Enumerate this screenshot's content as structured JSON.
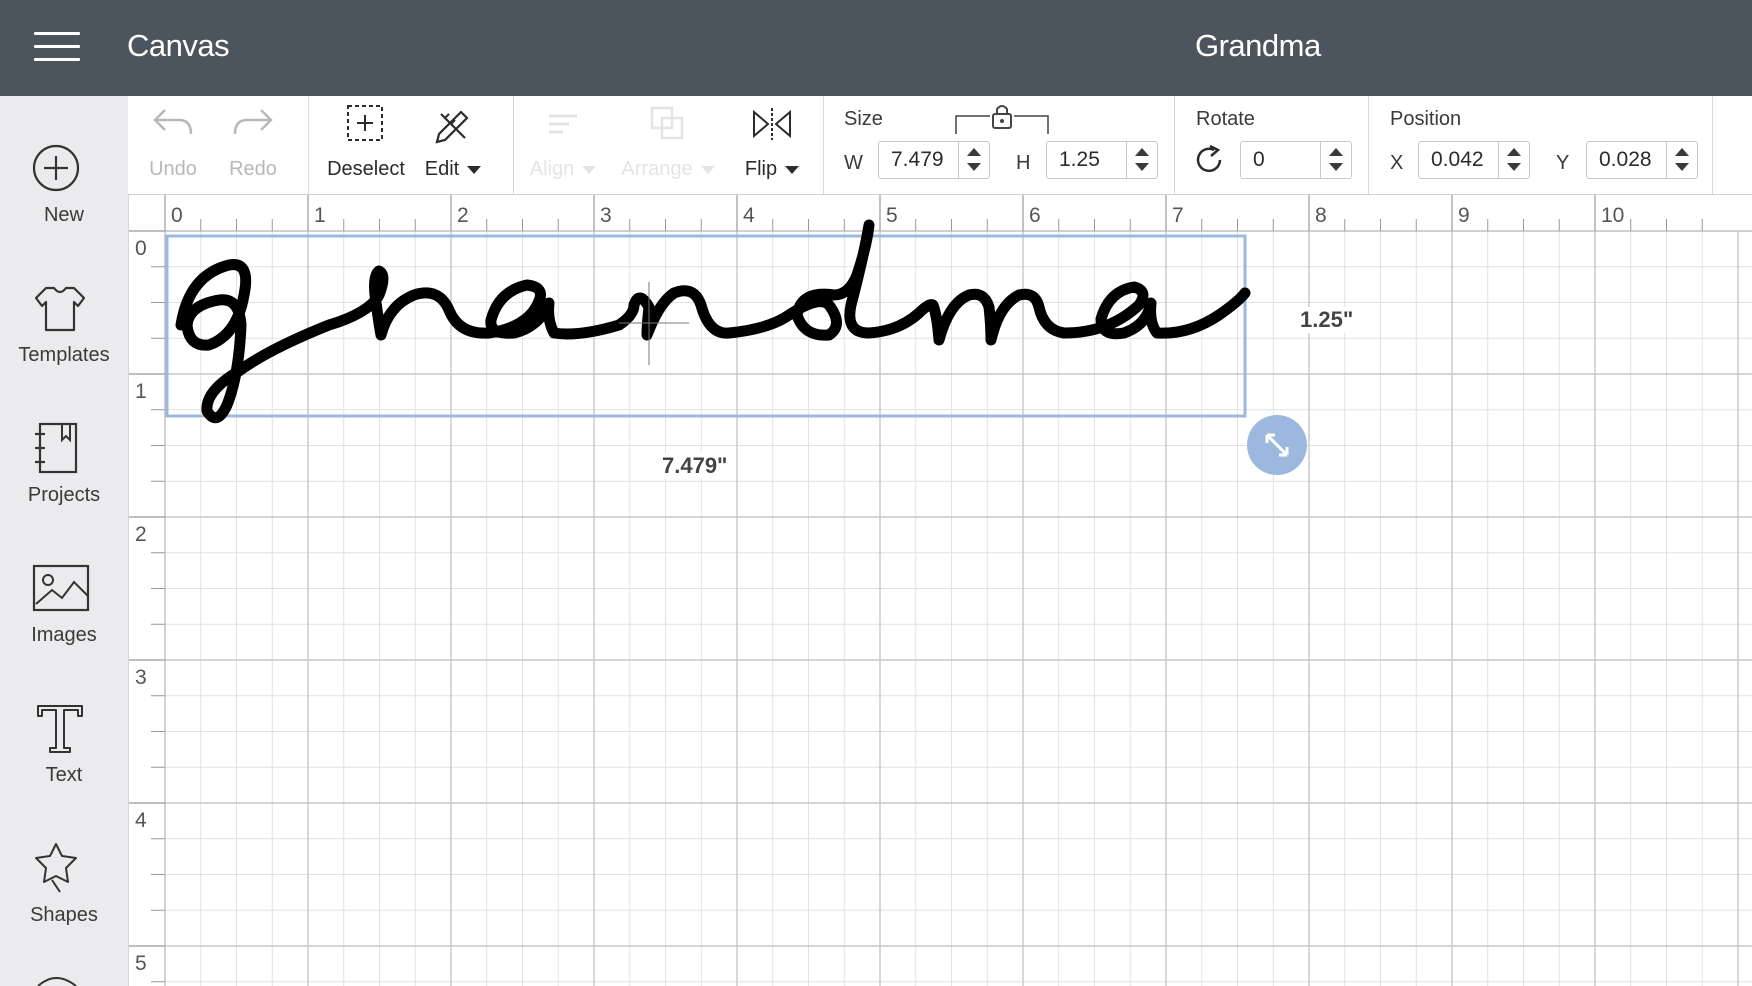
{
  "header": {
    "app_title": "Canvas",
    "doc_title": "Grandma",
    "menu_icon": "hamburger-menu-icon"
  },
  "sidebar": {
    "items": [
      {
        "label": "New",
        "icon": "plus-circle-icon"
      },
      {
        "label": "Templates",
        "icon": "tshirt-icon"
      },
      {
        "label": "Projects",
        "icon": "notebook-icon"
      },
      {
        "label": "Images",
        "icon": "image-icon"
      },
      {
        "label": "Text",
        "icon": "text-T-icon"
      },
      {
        "label": "Shapes",
        "icon": "shapes-icon"
      }
    ]
  },
  "toolbar": {
    "undo": "Undo",
    "redo": "Redo",
    "deselect": "Deselect",
    "edit": "Edit",
    "align": "Align",
    "arrange": "Arrange",
    "flip": "Flip",
    "size": {
      "title": "Size",
      "w_label": "W",
      "w_value": "7.479",
      "h_label": "H",
      "h_value": "1.25"
    },
    "rotate": {
      "title": "Rotate",
      "value": "0"
    },
    "position": {
      "title": "Position",
      "x_label": "X",
      "x_value": "0.042",
      "y_label": "Y",
      "y_value": "0.028"
    }
  },
  "canvas": {
    "ruler_h": [
      "0",
      "1",
      "2",
      "3",
      "4",
      "5",
      "6",
      "7",
      "8",
      "9",
      "10"
    ],
    "ruler_v": [
      "0",
      "1",
      "2",
      "3",
      "4",
      "5"
    ],
    "text_object": "grandma",
    "width_label": "7.479\"",
    "height_label": "1.25\"",
    "selection_color": "#9db8df"
  }
}
